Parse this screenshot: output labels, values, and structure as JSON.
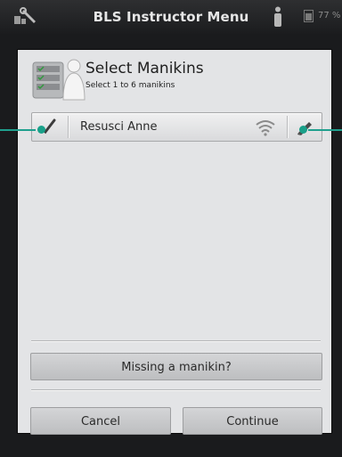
{
  "titlebar": {
    "title": "BLS Instructor Menu",
    "battery": "77 %",
    "icons": [
      "tools-icon",
      "person-icon",
      "battery-icon"
    ]
  },
  "dialog": {
    "title": "Select Manikins",
    "subtitle": "Select 1 to 6 manikins",
    "header_icon": "manikin-checklist-icon",
    "manikins": [
      {
        "name": "Resusci Anne",
        "selected": true,
        "connection": "wifi-icon",
        "action_icon": "edit-icon"
      }
    ],
    "missing_label": "Missing a manikin?",
    "cancel_label": "Cancel",
    "continue_label": "Continue"
  },
  "colors": {
    "accent": "#19a089",
    "background": "#1a1b1d",
    "dialog": "#e3e4e6"
  }
}
